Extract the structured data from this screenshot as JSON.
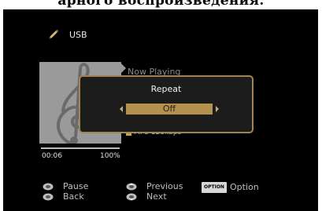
{
  "page_heading": "арного воспроизведения.",
  "source": {
    "label": "USB",
    "icon": "usb-pen-icon"
  },
  "now_playing": {
    "label": "Now Playing",
    "format": "MP3 128kbps",
    "time": "00:06",
    "percent": "100%",
    "progress": 1.0,
    "art_icon": "treble-clef-icon"
  },
  "popup": {
    "title": "Repeat",
    "value": "Off"
  },
  "footer": {
    "pause": "Pause",
    "back": "Back",
    "previous": "Previous",
    "next": "Next",
    "option_badge": "OPTION",
    "option": "Option"
  },
  "colors": {
    "accent": "#b4914f",
    "border": "#a08356",
    "screen": "#000000"
  }
}
